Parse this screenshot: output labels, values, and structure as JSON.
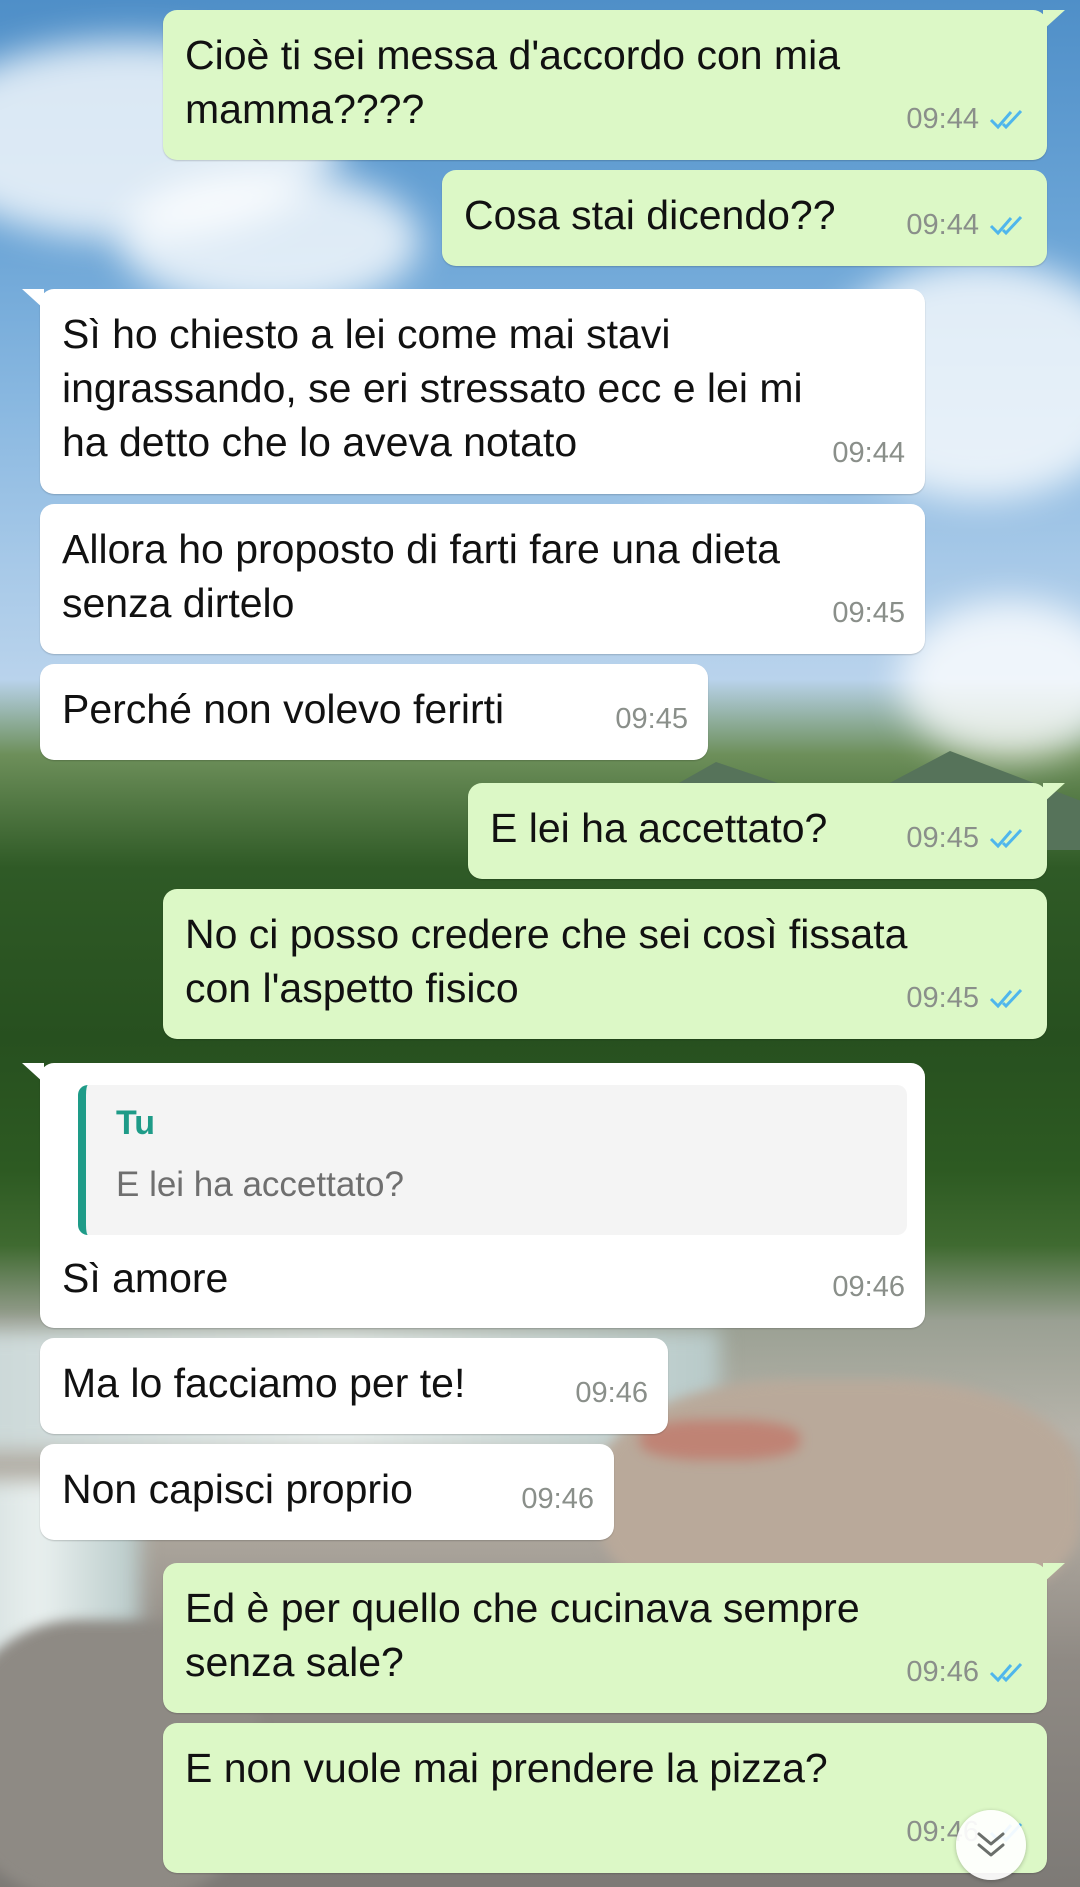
{
  "messages": [
    {
      "direction": "outgoing",
      "text": "Cioè ti sei messa d'accordo con mia\nmamma????",
      "time": "09:44",
      "status": "read"
    },
    {
      "direction": "outgoing",
      "text": "Cosa stai dicendo??",
      "time": "09:44",
      "status": "read"
    },
    {
      "direction": "incoming",
      "text": "Sì ho chiesto a lei come mai stavi\ningrassando, se eri stressato ecc e lei mi\nha detto che lo aveva notato",
      "time": "09:44"
    },
    {
      "direction": "incoming",
      "text": "Allora ho proposto di farti fare una dieta\nsenza dirtelo",
      "time": "09:45"
    },
    {
      "direction": "incoming",
      "text": "Perché non volevo ferirti",
      "time": "09:45"
    },
    {
      "direction": "outgoing",
      "text": "E lei ha accettato?",
      "time": "09:45",
      "status": "read"
    },
    {
      "direction": "outgoing",
      "text": "No ci posso credere che sei così fissata\ncon l'aspetto fisico",
      "time": "09:45",
      "status": "read"
    },
    {
      "direction": "incoming",
      "text": "Sì amore",
      "time": "09:46",
      "reply_to": {
        "author": "Tu",
        "text": "E lei ha accettato?"
      }
    },
    {
      "direction": "incoming",
      "text": "Ma lo facciamo per te!",
      "time": "09:46"
    },
    {
      "direction": "incoming",
      "text": "Non capisci proprio",
      "time": "09:46"
    },
    {
      "direction": "outgoing",
      "text": "Ed è per quello che cucinava sempre\nsenza sale?",
      "time": "09:46",
      "status": "read"
    },
    {
      "direction": "outgoing",
      "text": "E non vuole mai prendere la pizza?",
      "time": "09:46",
      "status": "read"
    }
  ],
  "scroll_button": {
    "icon": "chevron-double-down-icon"
  },
  "colors": {
    "outgoing_bubble": "#dcf8c6",
    "incoming_bubble": "#ffffff",
    "read_tick": "#4fb6ec",
    "reply_accent": "#1e9b88"
  }
}
